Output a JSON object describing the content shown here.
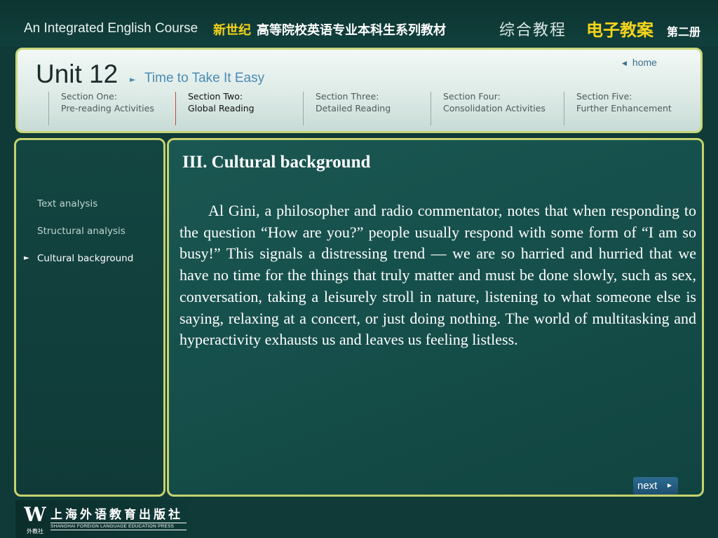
{
  "banner": {
    "course_title": "An Integrated English Course",
    "series_highlight": "新世纪",
    "series_rest": "高等院校英语专业本科生系列教材",
    "book_name": "综合教程",
    "courseware": "电子教案",
    "volume": "第二册"
  },
  "header": {
    "unit_title": "Unit 12",
    "unit_subtitle": "Time to Take It Easy",
    "home_label": "home",
    "sections": [
      {
        "line1": "Section One:",
        "line2": "Pre-reading Activities"
      },
      {
        "line1": "Section Two:",
        "line2": "Global Reading"
      },
      {
        "line1": "Section Three:",
        "line2": "Detailed Reading"
      },
      {
        "line1": "Section Four:",
        "line2": "Consolidation Activities"
      },
      {
        "line1": "Section Five:",
        "line2": "Further Enhancement"
      }
    ],
    "active_section": "Section Two:"
  },
  "sidebar": {
    "items": [
      {
        "label": "Text analysis"
      },
      {
        "label": "Structural analysis"
      },
      {
        "label": "Cultural background"
      }
    ],
    "active_item": "Cultural background"
  },
  "content": {
    "title": "III. Cultural background",
    "body": "Al Gini, a philosopher and radio commentator, notes that when responding to the question “How are you?” people usually respond with some form of “I am so busy!” This signals a distressing trend — we are so harried and hurried that we have no time for the things that truly matter and must be done slowly, such as sex, conversation, taking a leisurely stroll in nature, listening to what someone else is saying, relaxing at a concert, or just doing nothing. The world of multitasking and hyperactivity exhausts us and leaves us feeling listless.",
    "next_label": "next"
  },
  "footer": {
    "logo_mark": "W",
    "logo_caption": "外教社",
    "publisher_cn": "上海外语教育出版社",
    "publisher_en": "SHANGHAI FOREIGN LANGUAGE EDUCATION PRESS"
  },
  "colors": {
    "background": "#0f3a37",
    "panel_border": "#c5d26e",
    "accent_yellow": "#f5d51c",
    "link_blue": "#4a8bb4",
    "active_section_divider": "#c4473c"
  },
  "icons": {
    "home": "triangle-left-icon",
    "next": "triangle-right-icon",
    "subtitle": "triangle-right-icon",
    "active_item": "triangle-right-icon"
  }
}
